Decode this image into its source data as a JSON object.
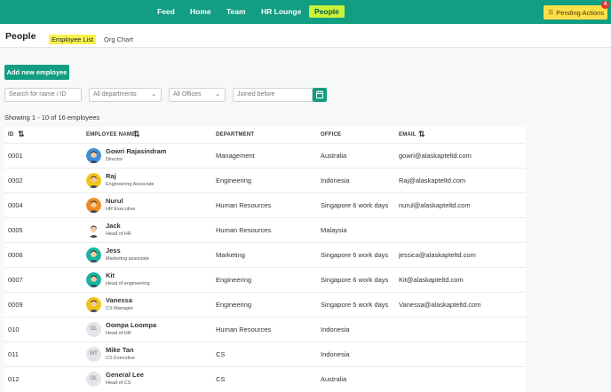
{
  "nav": {
    "items": [
      "Feed",
      "Home",
      "Team",
      "HR Lounge",
      "People"
    ],
    "active": "People",
    "pending_label": "Pending Actions",
    "pending_count": "4"
  },
  "page": {
    "title": "People",
    "tabs": [
      "Employee List",
      "Org Chart"
    ],
    "active_tab": "Employee List"
  },
  "toolbar": {
    "add_label": "Add new employee"
  },
  "filters": {
    "search_placeholder": "Search for name / ID",
    "department": "All departments",
    "office": "All Offices",
    "joined_placeholder": "Joined before"
  },
  "showing": "Showing 1 - 10 of 16 employees",
  "table": {
    "headers": {
      "id": "ID",
      "name": "EMPLOYEE NAME",
      "department": "DEPARTMENT",
      "office": "OFFICE",
      "email": "EMAIL"
    },
    "rows": [
      {
        "id": "0001",
        "name": "Gowri Rajasindram",
        "title": "Director",
        "department": "Management",
        "office": "Australia",
        "email": "gowri@alaskapteltd.com",
        "avatar": "photo",
        "avatar_bg": "#3d8fd9",
        "hair": "#2a1b12"
      },
      {
        "id": "0002",
        "name": "Raj",
        "title": "Engineering Associate",
        "department": "Engineering",
        "office": "Indonesia",
        "email": "Raj@alaskapteltd.com",
        "avatar": "photo",
        "avatar_bg": "#f0c419",
        "hair": "#3a2a1a"
      },
      {
        "id": "0004",
        "name": "Nurul",
        "title": "HR Executive",
        "department": "Human Resources",
        "office": "Singapore 6 work days",
        "email": "nurul@alaskapteltd.com",
        "avatar": "photo",
        "avatar_bg": "#f08a24",
        "hair": "#1e1b1a"
      },
      {
        "id": "0005",
        "name": "Jack",
        "title": "Head of HR",
        "department": "Human Resources",
        "office": "Malaysia",
        "email": "",
        "avatar": "photo",
        "avatar_bg": "#ffffff",
        "hair": "#2b2420"
      },
      {
        "id": "0006",
        "name": "Jess",
        "title": "Marketing associate",
        "department": "Marketing",
        "office": "Singapore 6 work days",
        "email": "jessica@alaskapteltd.com",
        "avatar": "photo",
        "avatar_bg": "#17b3a3",
        "hair": "#2a1d16"
      },
      {
        "id": "0007",
        "name": "Kit",
        "title": "Head of engineering",
        "department": "Engineering",
        "office": "Singapore 6 work days",
        "email": "Kit@alaskapteltd.com",
        "avatar": "photo",
        "avatar_bg": "#17b3a3",
        "hair": "#1e1b1a"
      },
      {
        "id": "0009",
        "name": "Vanessa",
        "title": "CS Manager",
        "department": "Engineering",
        "office": "Singapore 5 work days",
        "email": "Vanessa@alaskapteltd.com",
        "avatar": "photo",
        "avatar_bg": "#f0c419",
        "hair": "#2a1d16"
      },
      {
        "id": "010",
        "name": "Oompa Loompa",
        "title": "Head of HR",
        "department": "Human Resources",
        "office": "Indonesia",
        "email": "",
        "avatar": "OL"
      },
      {
        "id": "011",
        "name": "Mike Tan",
        "title": "CS Executive",
        "department": "CS",
        "office": "Indonesia",
        "email": "",
        "avatar": "MT"
      },
      {
        "id": "012",
        "name": "General Lee",
        "title": "Head of CS",
        "department": "CS",
        "office": "Australia",
        "email": "",
        "avatar": "GL"
      }
    ]
  },
  "colors": {
    "brand": "#129e82",
    "active_tab_highlight": "#f9f24e",
    "nav_active_highlight": "#c9f23a",
    "pending_bg": "#fce04a",
    "badge": "#e5322d"
  },
  "icons": {
    "calendar": "calendar-icon",
    "sort": "sort-icon",
    "pending": "list-icon",
    "chevron": "chevron-down-icon"
  }
}
